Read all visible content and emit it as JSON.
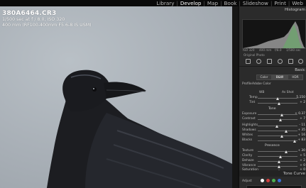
{
  "modules": {
    "items": [
      "Library",
      "Develop",
      "Map",
      "Book",
      "Slideshow",
      "Print",
      "Web"
    ],
    "active": "Develop",
    "separator": "|"
  },
  "photo_info": {
    "filename": "380A6464.CR3",
    "exposure": "1/500 sec at f / 8.0, ISO 320",
    "lens": "400 mm (RF100-400mm F5.6-8 IS USM)"
  },
  "panel": {
    "histogram_label": "Histogram",
    "hist_left_value": "ISO 320",
    "hist_mid_value": "400 mm",
    "hist_f": "f/8.0",
    "hist_shutter": "1/500 sec",
    "original_photo": "Original Photo",
    "basic_label": "Basic",
    "profile_label": "Profile",
    "profile_value": "Adobe Color",
    "treatment_color": "Color",
    "treatment_bw": "B&W",
    "treatment_hdr": "HDR",
    "wb_label": "WB",
    "wb_value": "As Shot",
    "temp_label": "Temp",
    "temp_value": "5,150",
    "tint_label": "Tint",
    "tint_value": "+ 2",
    "tone_label": "Tone",
    "exposure_label": "Exposure",
    "exposure_value": "+ 0.37",
    "contrast_label": "Contrast",
    "contrast_value": "+ 7",
    "highlights_label": "Highlights",
    "highlights_value": "- 11",
    "shadows_label": "Shadows",
    "shadows_value": "+ 35",
    "whites_label": "Whites",
    "whites_value": "+ 16",
    "blacks_label": "Blacks",
    "blacks_value": "+ 83",
    "presence_label": "Presence",
    "texture_label": "Texture",
    "texture_value": "+ 30",
    "clarity_label": "Clarity",
    "clarity_value": "+ 5",
    "dehaze_label": "Dehaze",
    "dehaze_value": "+ 2",
    "vibrance_label": "Vibrance",
    "vibrance_value": "+ 0",
    "saturation_label": "Saturation",
    "saturation_value": "+ 0",
    "tone_curve_label": "Tone Curve",
    "adjust_label": "Adjust"
  },
  "colors": {
    "accent_green": "#4caf50",
    "accent_blue": "#3b6fd4",
    "accent_red": "#d04040"
  }
}
